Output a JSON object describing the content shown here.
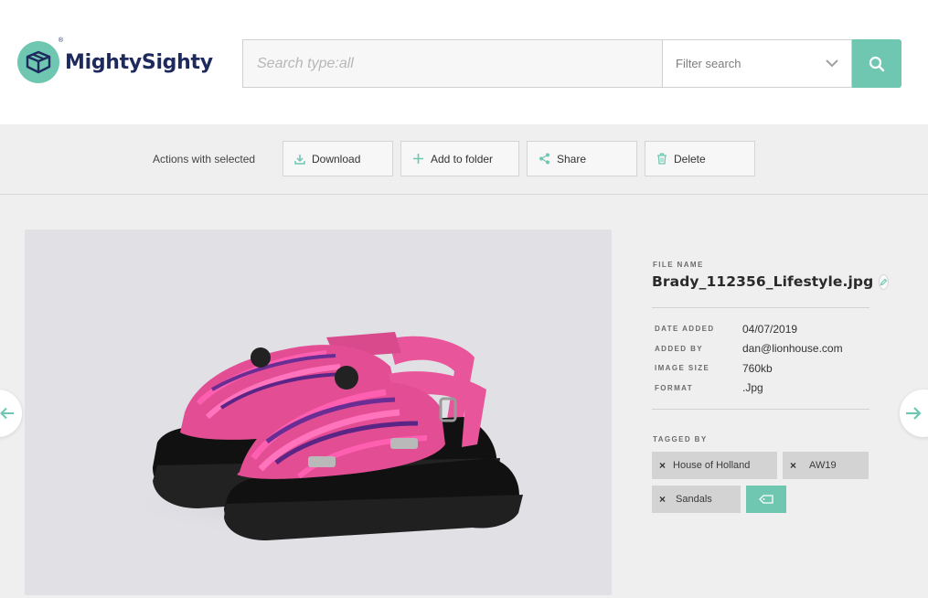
{
  "brand": {
    "name": "MightySighty",
    "registered": "®"
  },
  "search": {
    "placeholder": "Search type:all",
    "filter_label": "Filter search"
  },
  "toolbar": {
    "actions_label": "Actions with selected",
    "download_label": "Download",
    "add_to_folder_label": "Add to folder",
    "share_label": "Share",
    "delete_label": "Delete"
  },
  "file": {
    "name_label": "FILE NAME",
    "name": "Brady_112356_Lifestyle.jpg",
    "meta": [
      {
        "label": "DATE ADDED",
        "value": "04/07/2019"
      },
      {
        "label": "ADDED BY",
        "value": "dan@lionhouse.com"
      },
      {
        "label": "IMAGE SIZE",
        "value": "760kb"
      },
      {
        "label": "FORMAT",
        "value": ".Jpg"
      }
    ]
  },
  "tags": {
    "title": "TAGGED BY",
    "items": [
      {
        "label": "House of Holland"
      },
      {
        "label": "AW19"
      },
      {
        "label": "Sandals"
      }
    ],
    "remove_symbol": "×"
  },
  "icons": {
    "logo": "box-logo-icon",
    "search": "search-icon",
    "filter": "chevron-down-icon",
    "download": "download-icon",
    "add": "plus-icon",
    "share": "share-icon",
    "delete": "trash-icon",
    "edit": "pencil-icon",
    "prev": "arrow-left-icon",
    "next": "arrow-right-icon",
    "add_tag": "tag-icon"
  },
  "colors": {
    "accent": "#6fc7b1",
    "brand_text": "#1e2a5e"
  }
}
